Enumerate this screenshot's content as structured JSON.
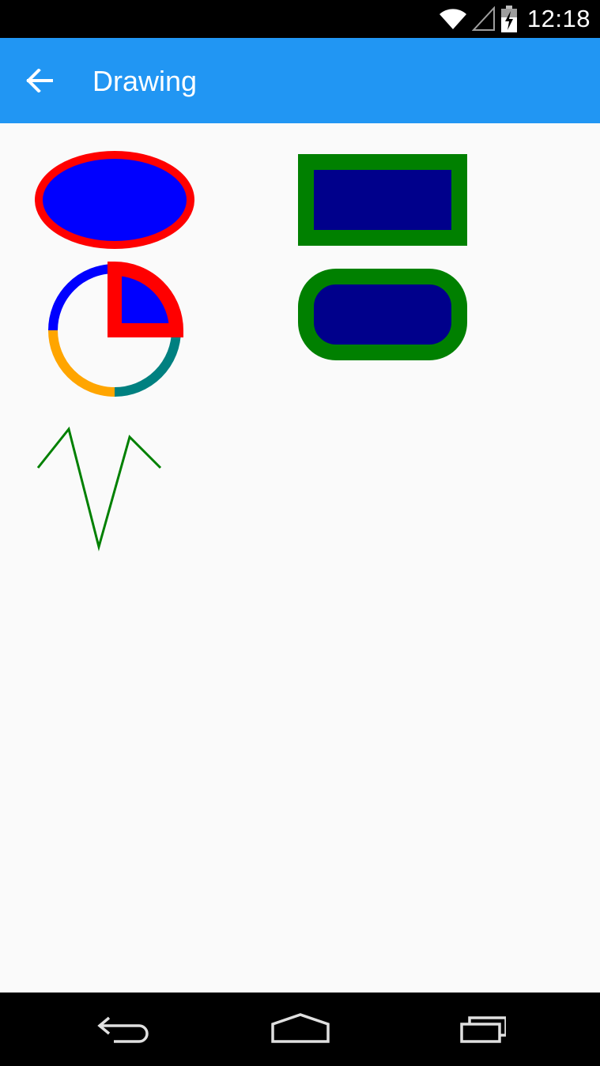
{
  "status_bar": {
    "time": "12:18",
    "icons": [
      "wifi-icon",
      "cell-signal-icon",
      "battery-charging-icon"
    ]
  },
  "app_bar": {
    "title": "Drawing",
    "back_icon": "arrow-back-icon",
    "background": "#2196f3"
  },
  "drawing": {
    "ellipse": {
      "fill": "#0000ff",
      "stroke": "#ff0000"
    },
    "rectangle": {
      "fill": "#00008b",
      "stroke": "#008000"
    },
    "rounded_rectangle": {
      "fill": "#00008b",
      "stroke": "#008000"
    },
    "ring": {
      "segments": [
        {
          "color": "#ff0000"
        },
        {
          "color": "#008080"
        },
        {
          "color": "#ffa500"
        },
        {
          "color": "#0000ff"
        }
      ]
    },
    "pie": {
      "fill": "#0000ff",
      "stroke": "#ff0000"
    },
    "polyline": {
      "stroke": "#008000"
    }
  },
  "nav_bar": {
    "buttons": [
      "back-nav-icon",
      "home-nav-icon",
      "recents-nav-icon"
    ]
  }
}
